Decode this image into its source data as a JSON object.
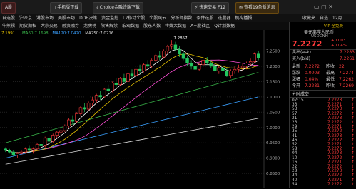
{
  "topbar": {
    "left_tab": "A股",
    "tabs": [
      "手机版下载",
      "Choice金融终端下载"
    ],
    "right_tabs": [
      "快速交易 F12",
      "查看19条新消息"
    ],
    "icons": [
      "phone-icon",
      "download-icon",
      "trade-icon",
      "mail-icon"
    ]
  },
  "menu_row1": [
    "自选股",
    "沪深京",
    "港股市场",
    "美股市场",
    "DDE决策",
    "资金监控",
    "L2移动个股",
    "个股风云",
    "分析师指数",
    "条件选股",
    "选股器",
    "机构播报"
  ],
  "menu_row1_right": [
    "收藏夹",
    "自选",
    "12月"
  ],
  "menu_row2": [
    "牛熊拐",
    "期货期权",
    "大宗交易",
    "融资融券",
    "龙虎榜",
    "限售解禁",
    "宏观数据",
    "股东人数",
    "传媒大数据",
    "A+股社区",
    "Q计划数据"
  ],
  "chart_header": {
    "prefix": "7.1991",
    "ma60": "MA60:7.1698",
    "ma120": "MA120:7.0420",
    "ma250": "MA250:7.0216",
    "peak_label": "7.2857"
  },
  "price_axis": [
    "7.2500",
    "7.2000",
    "7.1500",
    "7.1000",
    "7.0500",
    "7.0000",
    "6.9500",
    "6.9000",
    "6.8500"
  ],
  "panel": {
    "vip": "VIP 全免费",
    "name": "美元离岸人民币",
    "code": "USDCNH",
    "price": "7.2272",
    "change": "+0.003",
    "change_pct": "+0.04%",
    "ask_label": "卖出(ask)",
    "ask": "7.2283",
    "bid_label": "买入(bid)",
    "bid": "7.2261",
    "stats": [
      {
        "l1": "最新",
        "v1": "7.2272",
        "l2": "昨收",
        "v2": "22"
      },
      {
        "l1": "涨跌",
        "v1": "0.0003",
        "l2": "最高",
        "v2": "7.2274"
      },
      {
        "l1": "涨幅",
        "v1": "0.04%",
        "l2": "最低",
        "v2": "7.2262"
      },
      {
        "l1": "今开",
        "v1": "7.2281",
        "l2": "昨收",
        "v2": "7.2269"
      }
    ],
    "ticks_header": "分时成交",
    "ticks": [
      {
        "t": "07:15",
        "p": "7.2273"
      },
      {
        "t": "33",
        "p": "7.2271"
      },
      {
        "t": "53",
        "p": "7.2273"
      },
      {
        "t": "57",
        "p": "7.2272"
      },
      {
        "t": "21",
        "p": "7.2273"
      },
      {
        "t": "23",
        "p": "7.2272"
      },
      {
        "t": "29",
        "p": "7.2271"
      },
      {
        "t": "35",
        "p": "7.2272"
      },
      {
        "t": "41",
        "p": "7.2273"
      },
      {
        "t": "46",
        "p": "7.2272"
      },
      {
        "t": "52",
        "p": "7.2271"
      },
      {
        "t": "58",
        "p": "7.2272"
      },
      {
        "t": "04",
        "p": "7.2273"
      },
      {
        "t": "10",
        "p": "7.2272"
      },
      {
        "t": "16",
        "p": "7.2271"
      },
      {
        "t": "22",
        "p": "7.2272"
      },
      {
        "t": "28",
        "p": "7.2273"
      },
      {
        "t": "34",
        "p": "7.2272"
      },
      {
        "t": "40",
        "p": "7.2271"
      },
      {
        "t": "54",
        "p": "7.2272"
      }
    ]
  },
  "colors": {
    "up": "#ff3b3b",
    "down": "#22c55e",
    "ma5": "#ffffff",
    "ma10": "#e5c100",
    "ma20": "#ff4fd8",
    "ma60": "#39b54a",
    "ma120": "#3aa0ff",
    "ma250": "#d9d9d9"
  },
  "chart_data": {
    "type": "candlestick",
    "ylim": [
      6.82,
      7.3
    ],
    "candles": [
      [
        6.93,
        6.935,
        6.92,
        6.925
      ],
      [
        6.925,
        6.93,
        6.915,
        6.92
      ],
      [
        6.92,
        6.925,
        6.905,
        6.91
      ],
      [
        6.91,
        6.92,
        6.9,
        6.915
      ],
      [
        6.915,
        6.925,
        6.91,
        6.92
      ],
      [
        6.92,
        6.935,
        6.915,
        6.93
      ],
      [
        6.93,
        6.94,
        6.92,
        6.925
      ],
      [
        6.925,
        6.935,
        6.915,
        6.93
      ],
      [
        6.93,
        6.95,
        6.925,
        6.945
      ],
      [
        6.945,
        6.955,
        6.93,
        6.94
      ],
      [
        6.94,
        6.97,
        6.935,
        6.965
      ],
      [
        6.965,
        6.975,
        6.95,
        6.955
      ],
      [
        6.955,
        6.98,
        6.95,
        6.975
      ],
      [
        6.975,
        6.99,
        6.965,
        6.985
      ],
      [
        6.985,
        7.0,
        6.975,
        6.99
      ],
      [
        6.99,
        7.01,
        6.985,
        7.005
      ],
      [
        7.005,
        7.03,
        7.0,
        7.025
      ],
      [
        7.025,
        7.04,
        7.01,
        7.02
      ],
      [
        7.02,
        7.05,
        7.015,
        7.045
      ],
      [
        7.045,
        7.07,
        7.04,
        7.065
      ],
      [
        7.065,
        7.08,
        7.05,
        7.06
      ],
      [
        7.06,
        7.085,
        7.055,
        7.08
      ],
      [
        7.08,
        7.1,
        7.07,
        7.09
      ],
      [
        7.09,
        7.11,
        7.08,
        7.105
      ],
      [
        7.105,
        7.12,
        7.09,
        7.1
      ],
      [
        7.1,
        7.13,
        7.095,
        7.125
      ],
      [
        7.125,
        7.14,
        7.115,
        7.12
      ],
      [
        7.12,
        7.15,
        7.115,
        7.145
      ],
      [
        7.145,
        7.16,
        7.13,
        7.14
      ],
      [
        7.14,
        7.165,
        7.135,
        7.16
      ],
      [
        7.16,
        7.175,
        7.145,
        7.15
      ],
      [
        7.15,
        7.18,
        7.145,
        7.175
      ],
      [
        7.175,
        7.19,
        7.16,
        7.17
      ],
      [
        7.17,
        7.195,
        7.165,
        7.19
      ],
      [
        7.19,
        7.205,
        7.175,
        7.185
      ],
      [
        7.185,
        7.21,
        7.18,
        7.205
      ],
      [
        7.205,
        7.22,
        7.19,
        7.2
      ],
      [
        7.2,
        7.225,
        7.195,
        7.22
      ],
      [
        7.22,
        7.24,
        7.21,
        7.235
      ],
      [
        7.235,
        7.25,
        7.22,
        7.23
      ],
      [
        7.23,
        7.255,
        7.225,
        7.25
      ],
      [
        7.25,
        7.27,
        7.24,
        7.265
      ],
      [
        7.265,
        7.2857,
        7.255,
        7.27
      ],
      [
        7.27,
        7.28,
        7.25,
        7.255
      ],
      [
        7.255,
        7.265,
        7.23,
        7.24
      ],
      [
        7.24,
        7.25,
        7.22,
        7.225
      ],
      [
        7.225,
        7.235,
        7.2,
        7.21
      ],
      [
        7.21,
        7.22,
        7.19,
        7.2
      ],
      [
        7.2,
        7.215,
        7.185,
        7.19
      ],
      [
        7.19,
        7.21,
        7.185,
        7.205
      ],
      [
        7.205,
        7.225,
        7.2,
        7.22
      ],
      [
        7.22,
        7.23,
        7.205,
        7.21
      ],
      [
        7.21,
        7.22,
        7.195,
        7.2
      ],
      [
        7.2,
        7.21,
        7.18,
        7.185
      ],
      [
        7.185,
        7.2,
        7.175,
        7.195
      ],
      [
        7.195,
        7.205,
        7.18,
        7.185
      ],
      [
        7.185,
        7.195,
        7.165,
        7.17
      ],
      [
        7.17,
        7.19,
        7.16,
        7.185
      ],
      [
        7.185,
        7.2,
        7.175,
        7.19
      ],
      [
        7.19,
        7.205,
        7.18,
        7.195
      ],
      [
        7.195,
        7.21,
        7.185,
        7.2
      ],
      [
        7.2,
        7.215,
        7.19,
        7.21
      ],
      [
        7.21,
        7.225,
        7.2,
        7.215
      ],
      [
        7.215,
        7.245,
        7.21,
        7.24
      ],
      [
        7.24,
        7.25,
        7.22,
        7.228
      ]
    ],
    "ma60": [
      6.95,
      7.18
    ],
    "ma120": [
      6.9,
      7.1
    ],
    "ma250": [
      6.88,
      7.03
    ]
  }
}
